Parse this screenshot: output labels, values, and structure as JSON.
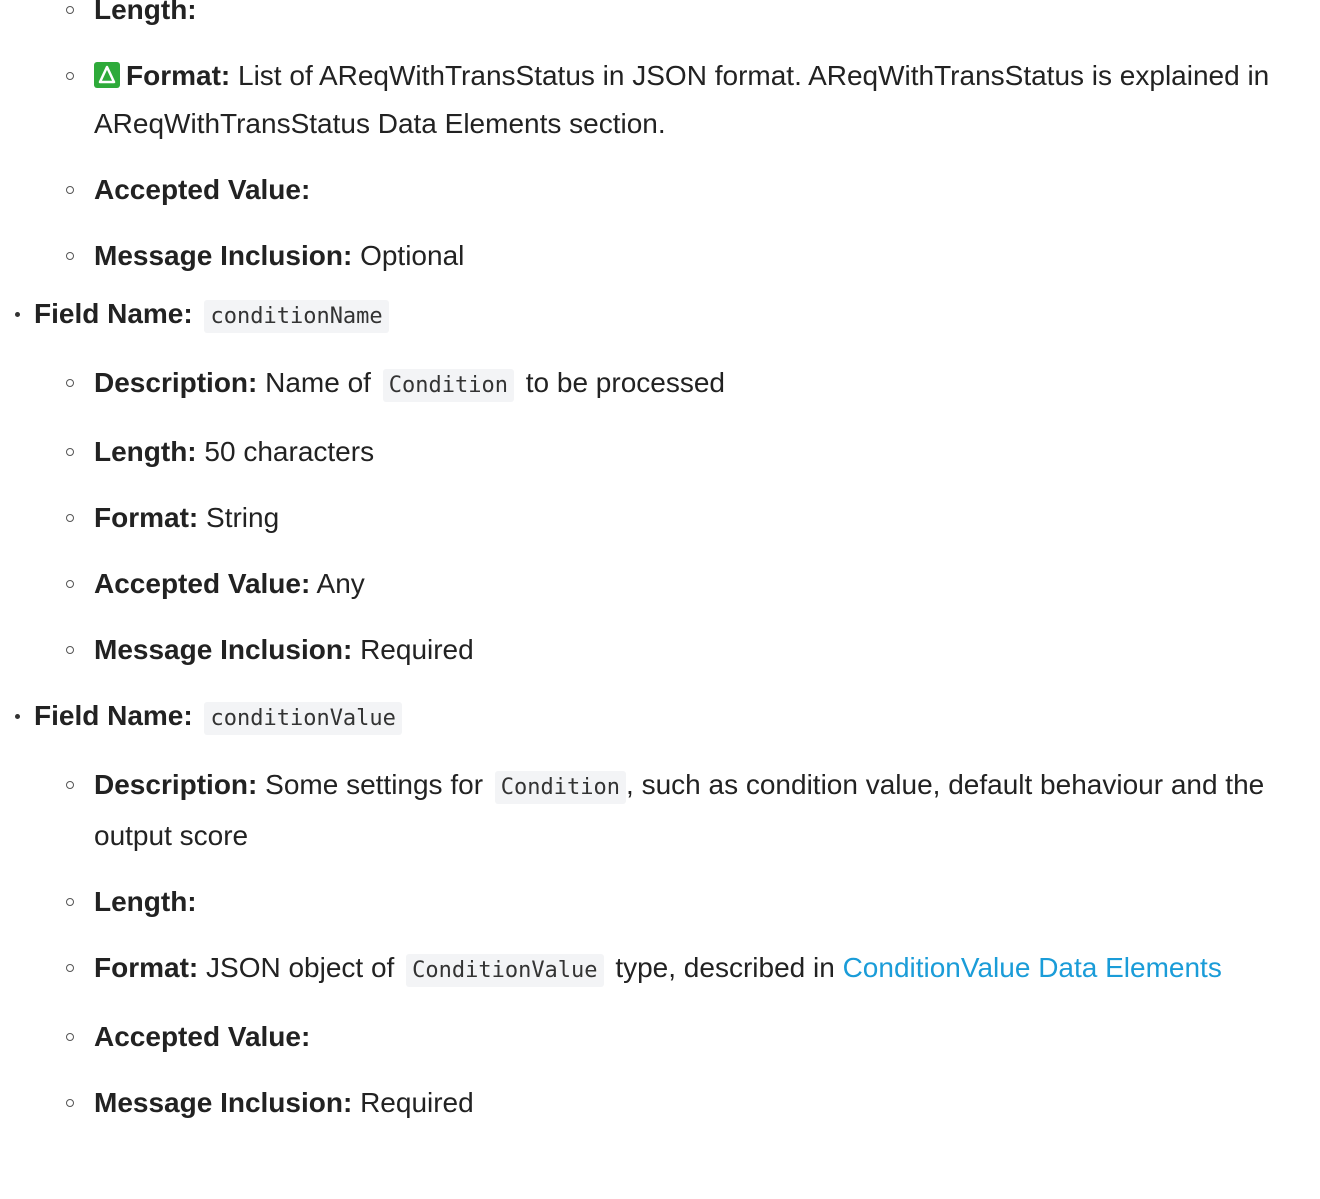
{
  "first_field": {
    "items": [
      {
        "label": "Length:",
        "value": ""
      },
      {
        "label": "Format:",
        "value": "List of AReqWithTransStatus in JSON format. AReqWithTransStatus is explained in AReqWithTransStatus Data Elements section.",
        "icon": "warning-triangle-icon"
      },
      {
        "label": "Accepted Value:",
        "value": ""
      },
      {
        "label": "Message Inclusion:",
        "value": "Optional"
      }
    ]
  },
  "condition_name": {
    "label": "Field Name:",
    "name": "conditionName",
    "description_label": "Description:",
    "description_pre": "Name of",
    "description_code": "Condition",
    "description_post": "to be processed",
    "length_label": "Length:",
    "length_value": "50 characters",
    "format_label": "Format:",
    "format_value": "String",
    "accepted_label": "Accepted Value:",
    "accepted_value": "Any",
    "inclusion_label": "Message Inclusion:",
    "inclusion_value": "Required"
  },
  "condition_value": {
    "label": "Field Name:",
    "name": "conditionValue",
    "description_label": "Description:",
    "description_pre": "Some settings for",
    "description_code": "Condition",
    "description_post": ", such as condition value, default behaviour and the output score",
    "length_label": "Length:",
    "format_label": "Format:",
    "format_pre": "JSON object of",
    "format_code": "ConditionValue",
    "format_post": "type, described in",
    "format_link": "ConditionValue Data Elements",
    "accepted_label": "Accepted Value:",
    "inclusion_label": "Message Inclusion:",
    "inclusion_value": "Required"
  },
  "colors": {
    "link": "#1a9cd8",
    "icon_bg": "#2eaa3a",
    "code_bg": "#f3f4f6"
  }
}
